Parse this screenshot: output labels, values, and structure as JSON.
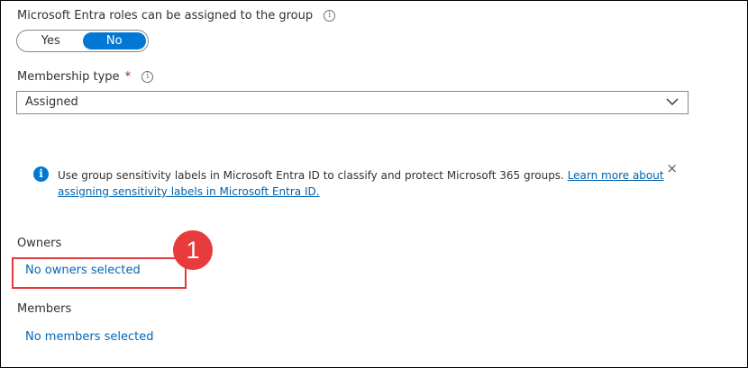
{
  "roles_field": {
    "label": "Microsoft Entra roles can be assigned to the group",
    "info_icon": "info-circle-icon",
    "toggle": {
      "options": [
        "Yes",
        "No"
      ],
      "selected": "No"
    }
  },
  "membership_field": {
    "label": "Membership type",
    "required_marker": "*",
    "info_icon": "info-circle-icon",
    "value": "Assigned",
    "chevron_icon": "chevron-down-icon"
  },
  "sensitivity_banner": {
    "icon": "info-filled-icon",
    "text": "Use group sensitivity labels in Microsoft Entra ID to classify and protect Microsoft 365 groups. ",
    "link_text": "Learn more about assigning sensitivity labels in Microsoft Entra ID.",
    "close_icon": "close-icon",
    "close_glyph": "×"
  },
  "owners": {
    "label": "Owners",
    "link": "No owners selected"
  },
  "members": {
    "label": "Members",
    "link": "No members selected"
  },
  "annotation": {
    "step_number": "1"
  },
  "colors": {
    "accent": "#0078d4",
    "link": "#0067b8",
    "annotation_red": "#e03a3a",
    "required_red": "#a4262c"
  }
}
